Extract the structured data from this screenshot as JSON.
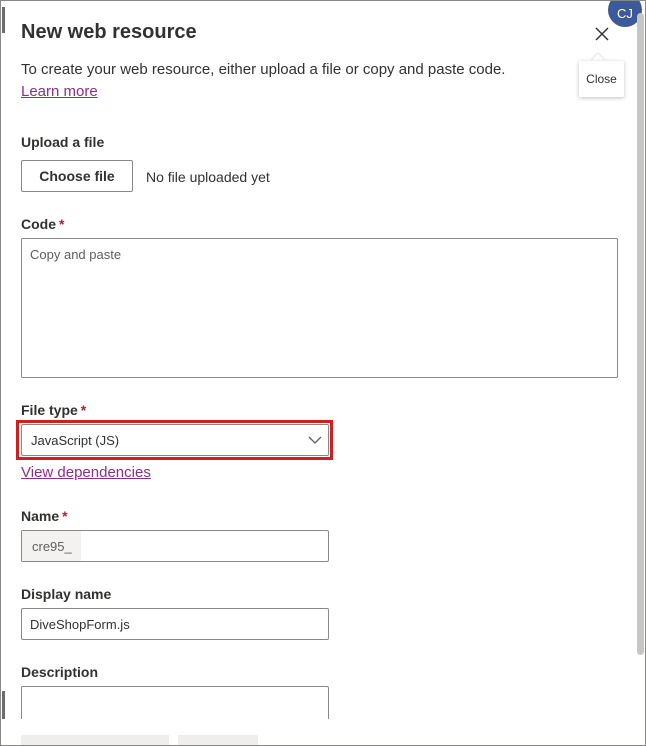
{
  "panel": {
    "title": "New web resource",
    "intro_text": "To create your web resource, either upload a file or copy and paste code.",
    "learn_more_link": "Learn more",
    "close_tooltip": "Close"
  },
  "header": {
    "avatar_initials": "CJ"
  },
  "upload": {
    "label": "Upload a file",
    "choose_file_button": "Choose file",
    "status": "No file uploaded yet"
  },
  "code": {
    "label": "Code",
    "required_marker": "*",
    "placeholder": "Copy and paste"
  },
  "file_type": {
    "label": "File type",
    "required_marker": "*",
    "selected_value": "JavaScript (JS)",
    "view_dependencies_link": "View dependencies"
  },
  "name_field": {
    "label": "Name",
    "required_marker": "*",
    "prefix": "cre95_",
    "value": ""
  },
  "display_name": {
    "label": "Display name",
    "value": "DiveShopForm.js"
  },
  "description": {
    "label": "Description",
    "value": ""
  },
  "colors": {
    "link": "#8a2f87",
    "required": "#a4262c",
    "highlight_border": "#d11f1f",
    "avatar_bg": "#3c5a99"
  },
  "icons": {
    "close": "close-icon",
    "dropdown": "chevron-down-icon"
  }
}
